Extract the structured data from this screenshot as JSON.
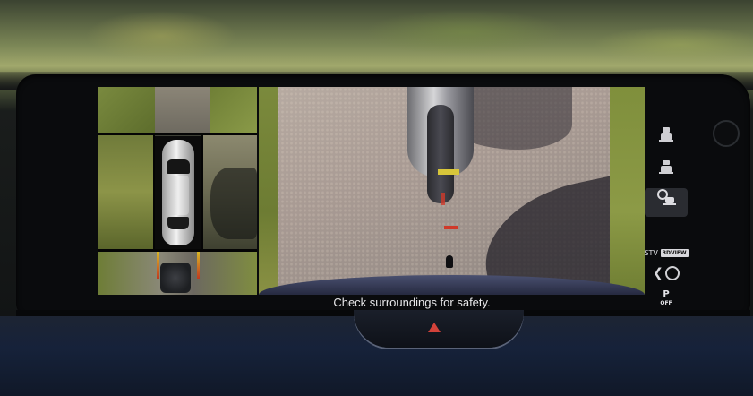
{
  "screen": {
    "warning_text": "Check surroundings for safety."
  },
  "views": {
    "left": "birds-eye-view",
    "main": "rear-camera-view"
  },
  "controls": {
    "camera_buttons": [
      {
        "icon": "front-camera-icon",
        "active": false
      },
      {
        "icon": "side-camera-icon",
        "active": false
      },
      {
        "icon": "zoom-camera-icon",
        "active": true
      }
    ],
    "stv_label": "STV",
    "stv_badge": "3DVIEW",
    "back_icon": "chevron-left-icon",
    "park_off_label": "P",
    "park_off_sub": "OFF"
  },
  "colors": {
    "guide_yellow": "#d9b826",
    "guide_red": "#d03a2a",
    "hazard_red": "#d2423a"
  }
}
